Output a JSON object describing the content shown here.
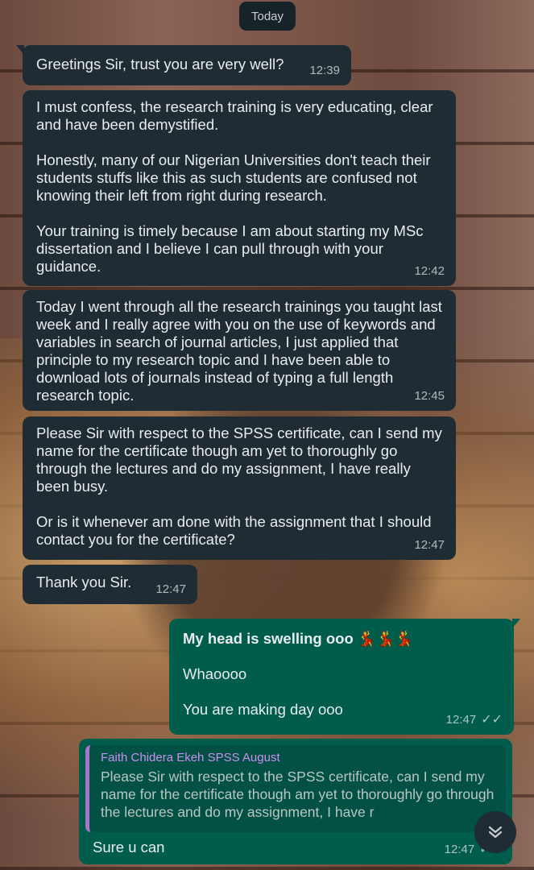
{
  "date_chip": "Today",
  "messages": [
    {
      "text": "Greetings Sir, trust you are very well?",
      "time": "12:39"
    },
    {
      "text": "I must confess, the research training is very educating, clear and have been demystified.\n\nHonestly, many of our Nigerian Universities don't teach their students stuffs like this as such students are confused not knowing their left from right during research.\n\nYour training is timely because I am about starting my MSc dissertation and I believe I can pull through with your guidance.",
      "time": "12:42"
    },
    {
      "text": "Today I went through all the research trainings you taught last week and I really agree with you on the use of keywords and variables in search of journal articles, I just applied that principle to my research topic and I have been able to download lots of journals instead of typing a full length research topic.",
      "time": "12:45"
    },
    {
      "text": "Please Sir with respect to the SPSS certificate, can I send my name for the certificate though am yet to thoroughly go through the lectures and do my assignment, I have really been busy.\n\nOr is it whenever am done with the assignment that I should contact you for the certificate?",
      "time": "12:47"
    },
    {
      "text": "Thank you Sir.",
      "time": "12:47"
    }
  ],
  "outgoing": {
    "line1": "My head is swelling ooo",
    "emoji": "💃💃💃",
    "line2": "Whaoooo",
    "line3": "You are making day ooo",
    "time": "12:47",
    "ticks": "✓✓"
  },
  "reply": {
    "quoted_name": "Faith Chidera Ekeh SPSS August",
    "quoted_text": "Please Sir with respect to the SPSS certificate, can I send my name for the certificate though am yet to thoroughly go through the lectures and do my assignment, I have r",
    "text": "Sure u can",
    "time": "12:47",
    "ticks": "✓✓"
  },
  "colors": {
    "incoming_bubble": "#202c33",
    "outgoing_bubble": "#005c4b",
    "quote_bar": "#a876c9"
  },
  "icons": {
    "scroll_down": "double-chevron-down-icon"
  }
}
